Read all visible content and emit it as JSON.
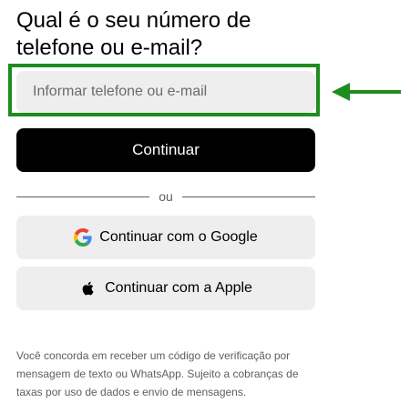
{
  "heading": "Qual é o seu número de telefone ou e-mail?",
  "input": {
    "placeholder": "Informar telefone ou e-mail",
    "value": ""
  },
  "buttons": {
    "continue_label": "Continuar",
    "google_label": "Continuar com o Google",
    "apple_label": "Continuar com a Apple"
  },
  "divider_text": "ou",
  "disclaimer": "Você concorda em receber um código de verificação por mensagem de texto ou WhatsApp. Sujeito a cobranças de taxas por uso de dados e envio de mensagens.",
  "icons": {
    "google": "google-logo-icon",
    "apple": "apple-logo-icon",
    "arrow": "arrow-left-icon"
  },
  "colors": {
    "highlight": "#1e8c1e",
    "primary_button": "#000000",
    "secondary_button": "#eeeeee",
    "muted_text": "#5e5e5e"
  }
}
